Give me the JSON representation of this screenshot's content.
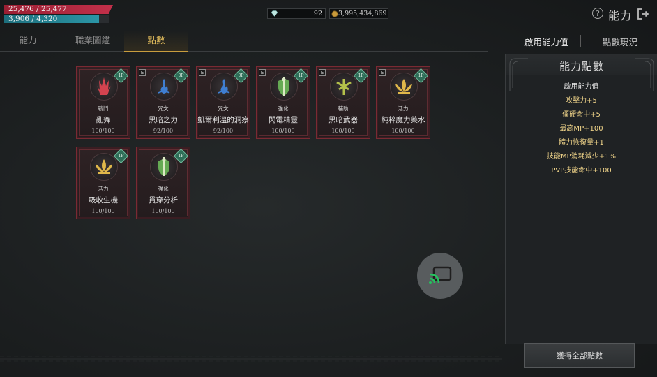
{
  "status": {
    "hp_text": "25,476 / 25,477",
    "mp_text": "3,906 / 4,320",
    "hp_fraction": 1.0,
    "mp_fraction": 0.904
  },
  "currency": {
    "gem_value": "92",
    "gold_value": "3,995,434,869"
  },
  "header": {
    "title": "能力",
    "help_icon": "question-circle-icon",
    "exit_icon": "exit-door-icon"
  },
  "tabs": [
    {
      "label": "能力",
      "active": false
    },
    {
      "label": "職業圖鑑",
      "active": false
    },
    {
      "label": "點數",
      "active": true
    }
  ],
  "right_tabs": [
    {
      "label": "啟用能力值",
      "active": true
    },
    {
      "label": "點數現況",
      "active": false
    }
  ],
  "cards": [
    {
      "badge_e": "",
      "badge_pt": "1P",
      "category": "戰鬥",
      "name": "亂舞",
      "value": "100/100",
      "color": "#d2434f",
      "icon": "red-claw-emblem-icon"
    },
    {
      "badge_e": "E",
      "badge_pt": "0P",
      "category": "咒文",
      "name": "黑暗之力",
      "value": "92/100",
      "color": "#3f7fd2",
      "icon": "blue-flame-emblem-icon"
    },
    {
      "badge_e": "E",
      "badge_pt": "0P",
      "category": "咒文",
      "name": "凱爾利溫的洞察",
      "value": "92/100",
      "color": "#3f7fd2",
      "icon": "blue-flame-emblem-icon"
    },
    {
      "badge_e": "E",
      "badge_pt": "1P",
      "category": "強化",
      "name": "閃電精靈",
      "value": "100/100",
      "color": "#6fbf5a",
      "icon": "green-shield-emblem-icon"
    },
    {
      "badge_e": "E",
      "badge_pt": "1P",
      "category": "輔助",
      "name": "黑暗武器",
      "value": "100/100",
      "color": "#b4c04a",
      "icon": "olive-cross-emblem-icon"
    },
    {
      "badge_e": "E",
      "badge_pt": "1P",
      "category": "活力",
      "name": "純粹魔力藥水",
      "value": "100/100",
      "color": "#e0b84a",
      "icon": "gold-lotus-emblem-icon"
    },
    {
      "badge_e": "",
      "badge_pt": "1P",
      "category": "活力",
      "name": "吸收生機",
      "value": "100/100",
      "color": "#e0b84a",
      "icon": "gold-lotus-emblem-icon"
    },
    {
      "badge_e": "",
      "badge_pt": "1P",
      "category": "強化",
      "name": "貫穿分析",
      "value": "100/100",
      "color": "#6fbf5a",
      "icon": "green-shield-emblem-icon"
    }
  ],
  "panel": {
    "title": "能力點數",
    "subtitle": "啟用能力值",
    "stats": [
      "攻擊力+5",
      "僵硬命中+5",
      "最高MP+100",
      "體力恢復量+1",
      "技能MP消耗減少+1%",
      "PVP技能命中+100"
    ]
  },
  "claim_button": "獲得全部點數",
  "cast_icon": "screen-cast-icon"
}
